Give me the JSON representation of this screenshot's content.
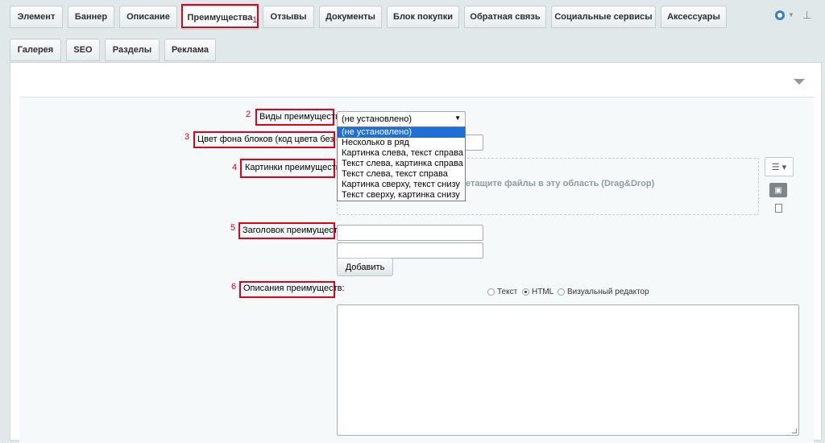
{
  "tabs_row1": [
    "Элемент",
    "Баннер",
    "Описание",
    "Преимущества",
    "Отзывы",
    "Документы",
    "Блок покупки",
    "Обратная связь",
    "Социальные сервисы",
    "Аксессуары"
  ],
  "tabs_row2": [
    "Галерея",
    "SEO",
    "Разделы",
    "Реклама"
  ],
  "active_tab": "Преимущества",
  "annotations": [
    "1",
    "2",
    "3",
    "4",
    "5",
    "6"
  ],
  "fields": {
    "views_label": "Виды преимуществ:",
    "bg_color_label": "Цвет фона блоков (код цвета без #):",
    "images_label": "Картинки преимуществ:",
    "title_label": "Заголовок преимуществ:",
    "desc_label": "Описания преимуществ:"
  },
  "select": {
    "value": "(не установлено)",
    "options": [
      "(не установлено)",
      "Несколько в ряд",
      "Картинка слева, текст справа",
      "Текст слева, картинка справа",
      "Текст слева, текст справа",
      "Картинка сверху, текст снизу",
      "Текст сверху, картинка снизу"
    ]
  },
  "dropzone_text": "етащите файлы в эту область (Drag&Drop)",
  "add_button": "Добавить",
  "editor_modes": [
    "Текст",
    "HTML",
    "Визуальный редактор"
  ],
  "editor_mode_selected": "HTML",
  "icons": {
    "settings": "gear-icon",
    "pin": "pin-icon",
    "collapse": "collapse-arrow-icon",
    "menu": "menu-icon",
    "image": "image-icon",
    "file": "file-icon"
  },
  "colors": {
    "highlight": "#e2001a",
    "selected_option": "#1e6fd9"
  }
}
